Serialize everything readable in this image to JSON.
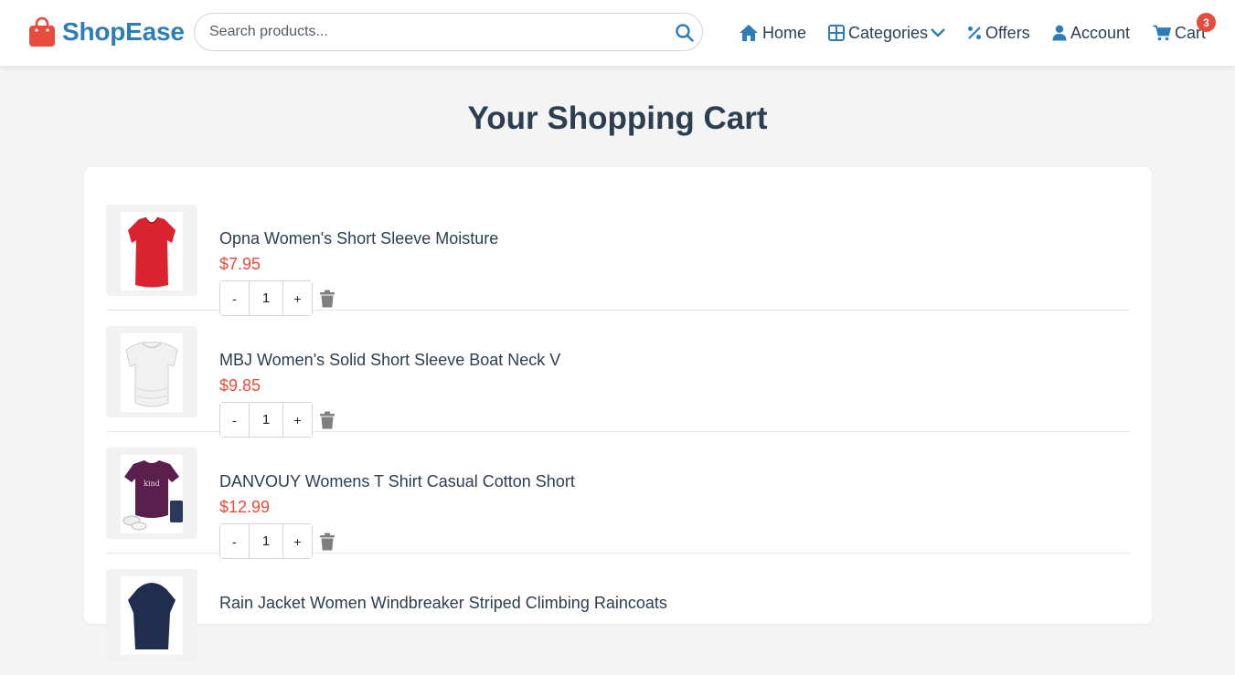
{
  "brand": {
    "name": "ShopEase",
    "color": "#2f7db8",
    "icon_color": "#e74c3c"
  },
  "search": {
    "placeholder": "Search products...",
    "value": ""
  },
  "nav": {
    "home": "Home",
    "categories": "Categories",
    "offers": "Offers",
    "account": "Account",
    "cart": "Cart",
    "cart_count": "3"
  },
  "page": {
    "title": "Your Shopping Cart"
  },
  "cart": {
    "items": [
      {
        "title": "Opna Women's Short Sleeve Moisture",
        "price": "$7.95",
        "quantity": "1",
        "minus": "-",
        "plus": "+",
        "image": "red v-neck t-shirt"
      },
      {
        "title": "MBJ Women's Solid Short Sleeve Boat Neck V",
        "price": "$9.85",
        "quantity": "1",
        "minus": "-",
        "plus": "+",
        "image": "white boat neck top"
      },
      {
        "title": "DANVOUY Womens T Shirt Casual Cotton Short",
        "price": "$12.99",
        "quantity": "1",
        "minus": "-",
        "plus": "+",
        "image": "purple graphic t-shirt"
      },
      {
        "title": "Rain Jacket Women Windbreaker Striped Climbing Raincoats",
        "price": "",
        "quantity": "",
        "minus": "",
        "plus": "",
        "image": "navy rain jacket"
      }
    ]
  },
  "colors": {
    "accent": "#2f7db8",
    "price": "#e74c3c",
    "text": "#2c3e50",
    "background": "#f4f4f4"
  }
}
